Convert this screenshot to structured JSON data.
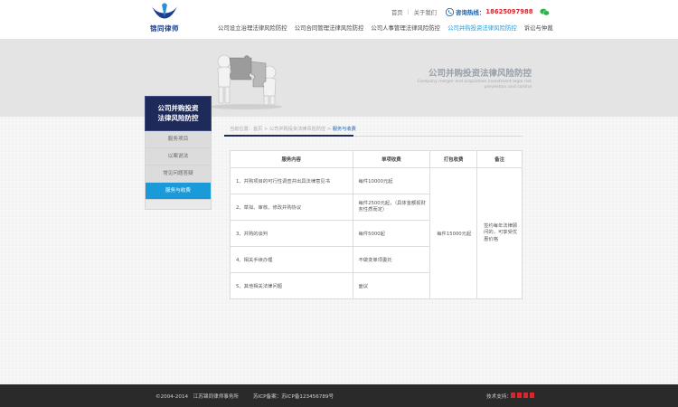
{
  "header": {
    "logo_text": "锦同律师",
    "top_links": [
      "首页",
      "关于我们"
    ],
    "hotline_label": "咨询热线：",
    "hotline_number": "18625097988",
    "nav": [
      {
        "label": "公司设立治理法律风险防控",
        "active": false
      },
      {
        "label": "公司合同管理法律风险防控",
        "active": false
      },
      {
        "label": "公司人事管理法律风险防控",
        "active": false
      },
      {
        "label": "公司并购投资法律风险防控",
        "active": true
      },
      {
        "label": "诉讼与仲裁",
        "active": false
      }
    ]
  },
  "banner": {
    "title": "公司并购投资法律风险防控",
    "subtitle": "Company merger and acquisition investment legal risk prevention and control"
  },
  "sidebar": {
    "title_line1": "公司并购投资",
    "title_line2": "法律风险防控",
    "items": [
      {
        "label": "服务项目",
        "active": false
      },
      {
        "label": "以案说法",
        "active": false
      },
      {
        "label": "常见问题答疑",
        "active": false
      },
      {
        "label": "服务与收费",
        "active": true
      }
    ]
  },
  "breadcrumb": {
    "prefix": "当前位置：首页 > 公司并购投资法律风险防控 > ",
    "current": "服务与收费"
  },
  "table": {
    "headers": [
      "服务内容",
      "单项收费",
      "打包收费",
      "备注"
    ],
    "rows": [
      {
        "content": "1、并购项目的可行性调查并出具法律意见书",
        "fee": "每件10000元起"
      },
      {
        "content": "2、草拟、审核、修改并购协议",
        "fee": "每件2500元起，（具体金额视财务性质而定）"
      },
      {
        "content": "3、并购的谈判",
        "fee": "每件5000起"
      },
      {
        "content": "4、相关手续办理",
        "fee": "不做变单项委托"
      },
      {
        "content": "5、其他相关法律问题",
        "fee": "面议"
      }
    ],
    "package_fee": "每件15000元起",
    "note": "签约每年法律顾问的，可享受优惠价格"
  },
  "footer": {
    "copyright": "©2004-2014　江苏锦同律师事务所",
    "icp": "苏ICP备案：苏ICP备123456789号",
    "support_label": "技术支持："
  },
  "colors": {
    "brand_navy": "#1d2a5a",
    "accent_blue": "#1a9ad8",
    "hotline_red": "#d9262c"
  }
}
